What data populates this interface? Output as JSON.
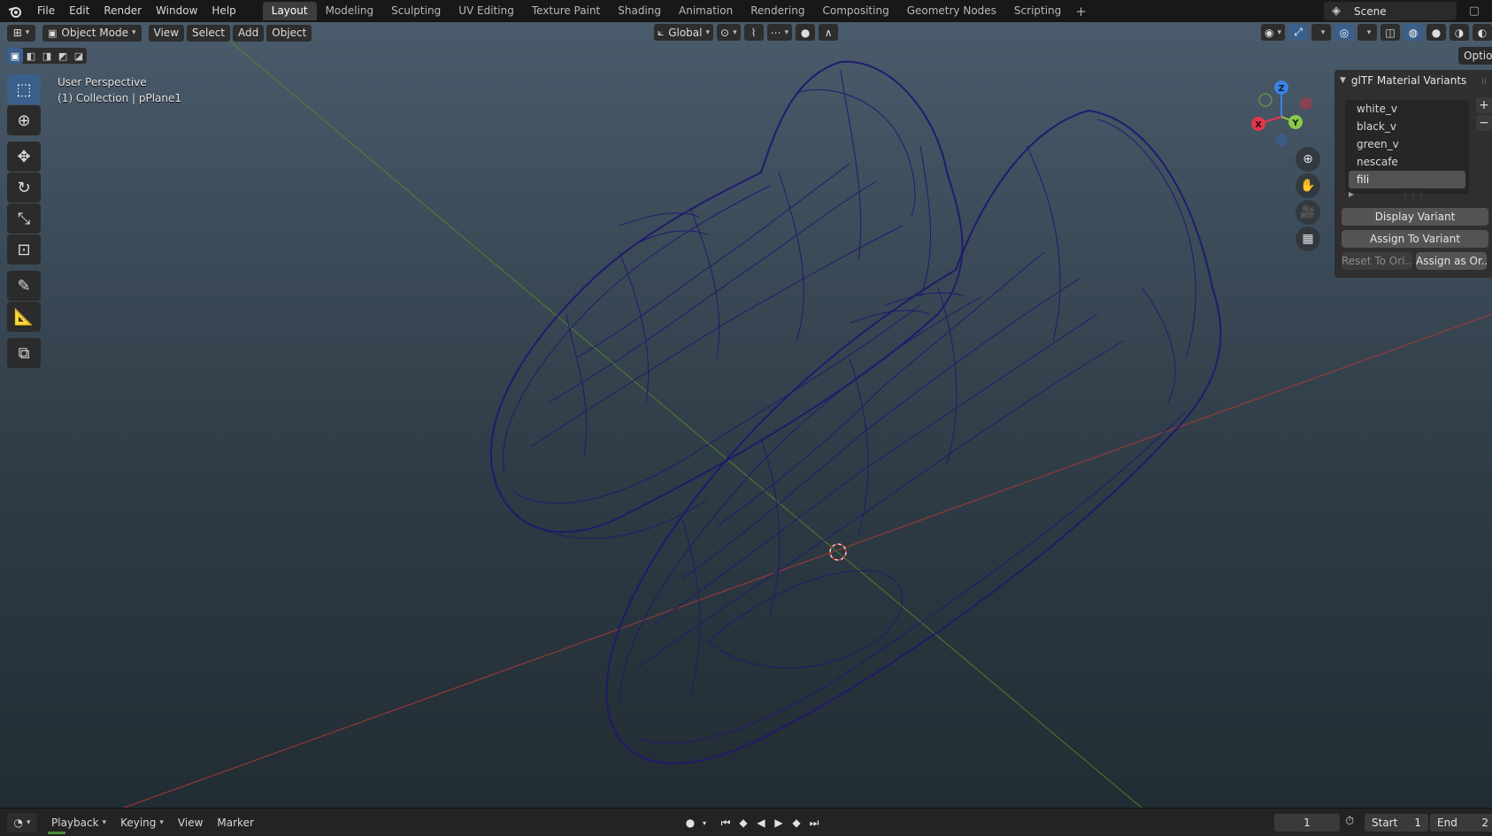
{
  "app": {
    "logo_icon": "blender-logo-icon",
    "menus": [
      "File",
      "Edit",
      "Render",
      "Window",
      "Help"
    ],
    "workspace_tabs": [
      "Layout",
      "Modeling",
      "Sculpting",
      "UV Editing",
      "Texture Paint",
      "Shading",
      "Animation",
      "Rendering",
      "Compositing",
      "Geometry Nodes",
      "Scripting"
    ],
    "active_workspace": "Layout",
    "add_workspace": "+",
    "scene_name": "Scene"
  },
  "viewport_header": {
    "mode": "Object Mode",
    "menus": [
      "View",
      "Select",
      "Add",
      "Object"
    ],
    "transform_orientation": "Global"
  },
  "viewport_info": {
    "perspective": "User Perspective",
    "collection": "(1) Collection | pPlane1"
  },
  "gizmo": {
    "axis_x": "X",
    "axis_y": "Y",
    "axis_z": "Z",
    "x_color": "#e5364f",
    "y_color": "#8bc94c",
    "z_color": "#3b84e3"
  },
  "options_label": "Options",
  "material_variants": {
    "title": "glTF Material Variants",
    "items": [
      "white_v",
      "black_v",
      "green_v",
      "nescafe",
      "fili"
    ],
    "selected_index": 4,
    "add_symbol": "+",
    "remove_symbol": "−",
    "display_variant": "Display Variant",
    "assign_to_variant": "Assign To Variant",
    "reset_to_original": "Reset To Ori...",
    "assign_as_original": "Assign as Or..."
  },
  "timeline": {
    "menus": [
      "Playback",
      "Keying",
      "View",
      "Marker"
    ],
    "current_frame": "1",
    "start_label": "Start",
    "start_value": "1",
    "end_label": "End",
    "end_value": "2"
  },
  "colors": {
    "wireframe": "#1e1a6e",
    "accent_blue": "#3a5f8a",
    "x_axis_line": "#a33a3a",
    "y_axis_line": "#5a8a2a"
  }
}
